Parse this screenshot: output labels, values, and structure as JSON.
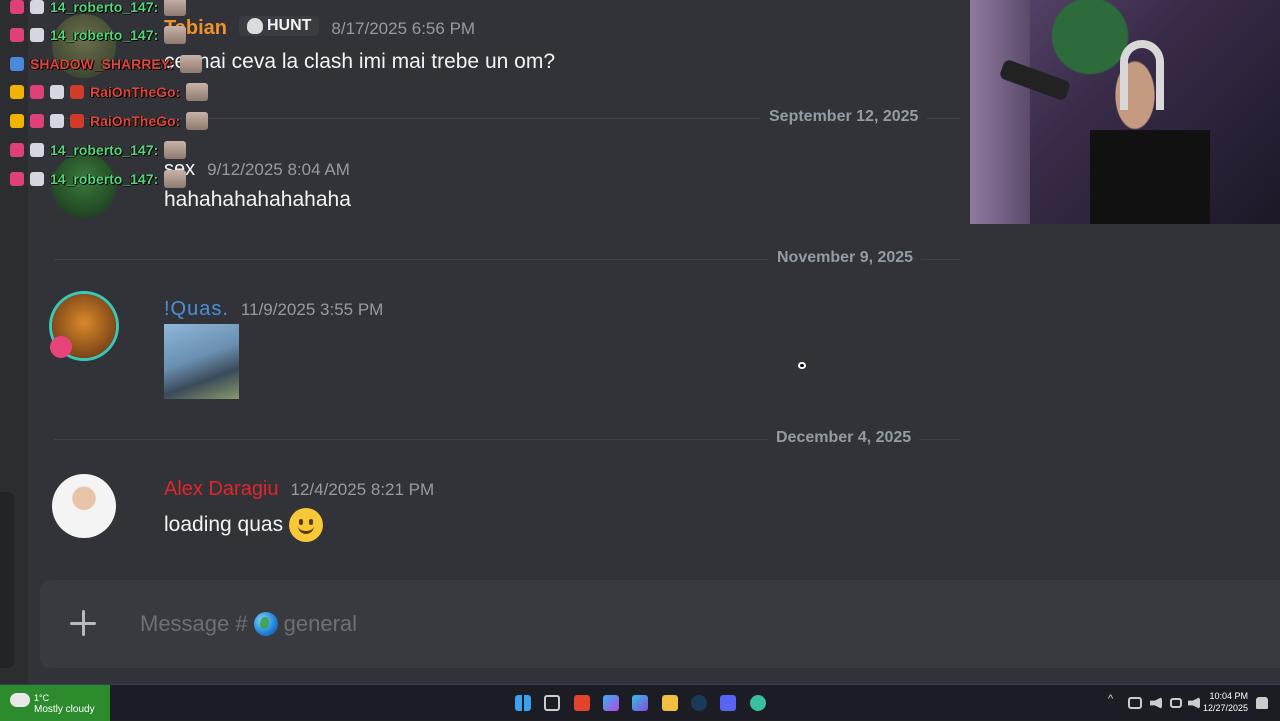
{
  "messages": [
    {
      "username": "Tabian",
      "tag": "HUNT",
      "timestamp": "8/17/2025 6:56 PM",
      "text": "ce mai ceva la clash imi mai trebe un om?"
    },
    {
      "username": "sex",
      "timestamp": "9/12/2025 8:04 AM",
      "text": "hahahahahahahaha"
    },
    {
      "username": "!Quas.",
      "timestamp": "11/9/2025 3:55 PM",
      "attachment": "image"
    },
    {
      "username": "Alex Daragiu",
      "timestamp": "12/4/2025 8:21 PM",
      "text": "loading quas"
    }
  ],
  "dividers": [
    "September 12, 2025",
    "November 9, 2025",
    "December 4, 2025"
  ],
  "composer": {
    "placeholder_prefix": "Message #",
    "channel": "general"
  },
  "stream_chat": [
    {
      "name": "14_roberto_147:"
    },
    {
      "name": "14_roberto_147:"
    },
    {
      "name": "SHADOW_SHARREY:"
    },
    {
      "name": "RaiOnTheGo:"
    },
    {
      "name": "RaiOnTheGo:"
    },
    {
      "name": "14_roberto_147:"
    },
    {
      "name": "14_roberto_147:"
    }
  ],
  "taskbar": {
    "weather_temp": "1°C",
    "weather_cond": "Mostly cloudy",
    "time": "10:04 PM",
    "date": "12/27/2025"
  },
  "colors": {
    "tabian": "#f0922d",
    "quas": "#4c8fd6",
    "alex": "#e0262b",
    "overlay_green": "#56d67a",
    "overlay_red": "#e0453a"
  }
}
